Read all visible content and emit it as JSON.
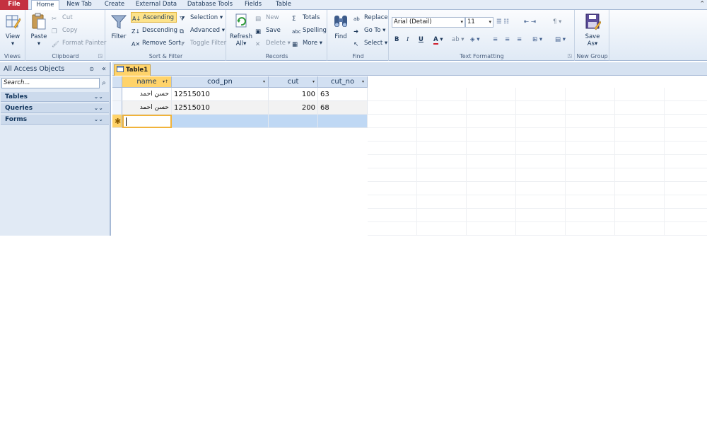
{
  "ribbon_tabs": [
    "File",
    "Home",
    "New Tab",
    "Create",
    "External Data",
    "Database Tools",
    "Fields",
    "Table"
  ],
  "active_tab": "Home",
  "groups": {
    "views": {
      "label": "Views",
      "view_label": "View",
      "arrow": "▾"
    },
    "clipboard": {
      "label": "Clipboard",
      "paste": "Paste",
      "cut": "Cut",
      "copy": "Copy",
      "format_painter": "Format Painter"
    },
    "sort_filter": {
      "label": "Sort & Filter",
      "filter": "Filter",
      "ascending": "Ascending",
      "descending": "Descending",
      "remove_sort": "Remove Sort",
      "selection": "Selection",
      "advanced": "Advanced",
      "toggle_filter": "Toggle Filter"
    },
    "records": {
      "label": "Records",
      "refresh": "Refresh",
      "refresh_sub": "All",
      "new": "New",
      "save": "Save",
      "delete": "Delete",
      "totals": "Totals",
      "spelling": "Spelling",
      "more": "More"
    },
    "find": {
      "label": "Find",
      "find": "Find",
      "replace": "Replace",
      "goto": "Go To",
      "select": "Select"
    },
    "text_formatting": {
      "label": "Text Formatting",
      "font": "Arial (Detail)",
      "size": "11",
      "bold": "B",
      "italic": "I",
      "underline": "U"
    },
    "new_group": {
      "label": "New Group",
      "save_as": "Save",
      "save_as_sub": "As"
    }
  },
  "nav": {
    "title": "All Access Objects",
    "search_placeholder": "Search...",
    "categories": [
      "Tables",
      "Queries",
      "Forms"
    ]
  },
  "document": {
    "tab_label": "Table1",
    "columns": [
      "name",
      "cod_pn",
      "cut",
      "cut_no"
    ],
    "rows": [
      [
        "حسن احمد",
        "12515010",
        "100",
        "63"
      ],
      [
        "حسن احمد",
        "12515010",
        "200",
        "68"
      ]
    ],
    "new_row_marker": "✱"
  },
  "colors": {
    "accent": "#ffd36a",
    "file_tab": "#c43140",
    "header": "#d2e0f2",
    "new_row": "#bfd8f4"
  }
}
